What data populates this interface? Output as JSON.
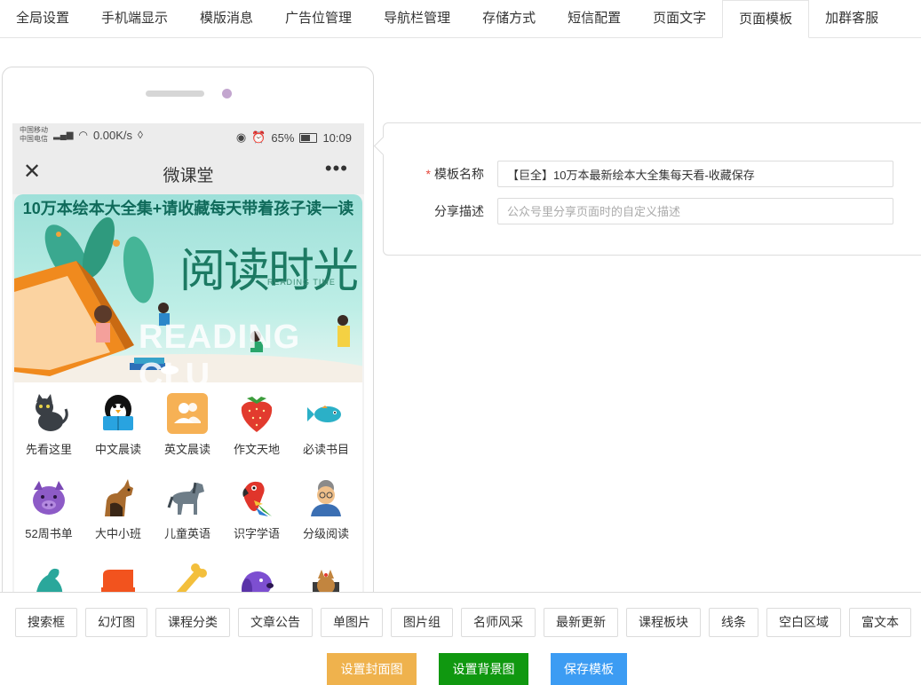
{
  "tabs": [
    "全局设置",
    "手机端显示",
    "模版消息",
    "广告位管理",
    "导航栏管理",
    "存储方式",
    "短信配置",
    "页面文字",
    "页面模板",
    "加群客服"
  ],
  "active_tab": "页面模板",
  "phone": {
    "status": {
      "carrier1": "中国移动",
      "carrier2": "中国电信",
      "net_speed": "0.00K/s",
      "battery": "65%",
      "time": "10:09"
    },
    "nav_title": "微课堂",
    "banner": {
      "headline": "10万本绘本大全集+请收藏每天带着孩子读一读",
      "title": "阅读时光",
      "subtitle": "READING TIME",
      "big_text": "READING CLU"
    },
    "grid_items": [
      {
        "label": "先看这里",
        "icon": "black-cat-icon"
      },
      {
        "label": "中文晨读",
        "icon": "penguin-reading-icon"
      },
      {
        "label": "英文晨读",
        "icon": "users-icon"
      },
      {
        "label": "作文天地",
        "icon": "strawberry-icon"
      },
      {
        "label": "必读书目",
        "icon": "fish-icon"
      },
      {
        "label": "52周书单",
        "icon": "pig-icon"
      },
      {
        "label": "大中小班",
        "icon": "dog-icon"
      },
      {
        "label": "儿童英语",
        "icon": "horse-icon"
      },
      {
        "label": "识字学语",
        "icon": "parrot-icon"
      },
      {
        "label": "分级阅读",
        "icon": "grandma-icon"
      }
    ]
  },
  "form": {
    "name_label": "模板名称",
    "name_value": "【巨全】10万本最新绘本大全集每天看-收藏保存",
    "desc_label": "分享描述",
    "desc_placeholder": "公众号里分享页面时的自定义描述"
  },
  "components": [
    "搜索框",
    "幻灯图",
    "课程分类",
    "文章公告",
    "单图片",
    "图片组",
    "名师风采",
    "最新更新",
    "课程板块",
    "线条",
    "空白区域",
    "富文本"
  ],
  "actions": {
    "cover": "设置封面图",
    "background": "设置背景图",
    "save": "保存模板"
  },
  "colors": {
    "cover_button": "#efb24d",
    "background_button": "#109810",
    "save_button": "#3c9cf3",
    "required_mark": "#e5473b"
  }
}
